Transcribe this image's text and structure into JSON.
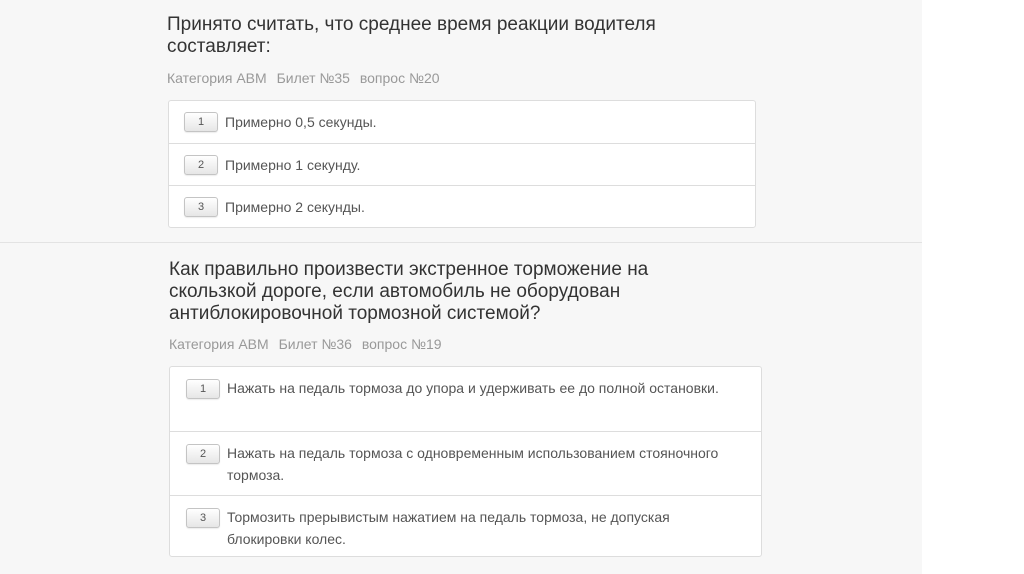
{
  "questions": [
    {
      "title": "Принято считать, что среднее время реакции водителя составляет:",
      "category": "Категория АВМ",
      "ticket": "Билет №35",
      "question_no": "вопрос №20",
      "answers": [
        {
          "number": "1",
          "text": "Примерно 0,5 секунды."
        },
        {
          "number": "2",
          "text": "Примерно 1 секунду."
        },
        {
          "number": "3",
          "text": "Примерно 2 секунды."
        }
      ]
    },
    {
      "title": "Как правильно произвести экстренное торможение на скользкой дороге, если автомобиль не оборудован антиблокировочной тормозной системой?",
      "category": "Категория АВМ",
      "ticket": "Билет №36",
      "question_no": "вопрос №19",
      "answers": [
        {
          "number": "1",
          "text": "Нажать на педаль тормоза до упора и удерживать ее до полной остановки."
        },
        {
          "number": "2",
          "text": "Нажать на педаль тормоза с одновременным использованием стояночного тормоза."
        },
        {
          "number": "3",
          "text": "Тормозить прерывистым нажатием на педаль тормоза, не допуская блокировки колес."
        }
      ]
    }
  ]
}
